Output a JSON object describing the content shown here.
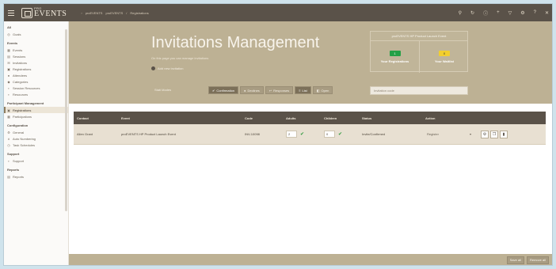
{
  "topbar": {
    "logo_small": "PRO",
    "logo_big": "EVENTS",
    "breadcrumbs": [
      "proEVENTS",
      "proEVENTS",
      "Registrations"
    ],
    "icons": [
      "pin-icon",
      "refresh-icon",
      "info-icon",
      "plus-icon",
      "filter-icon",
      "gear-icon",
      "help-icon",
      "close-icon"
    ]
  },
  "sidebar": {
    "top_section": "All",
    "top_item": "Goals",
    "sections": [
      {
        "title": "Events",
        "items": [
          "Events",
          "Sessions",
          "Invitations",
          "Registrations",
          "Attendees",
          "Categories",
          "Session Resources",
          "Resources"
        ]
      },
      {
        "title": "Participant Management",
        "items": [
          "Registrations",
          "Participations"
        ]
      },
      {
        "title": "Configuration",
        "items": [
          "General",
          "Auto Numbering",
          "Task Schedules"
        ]
      },
      {
        "title": "Support",
        "items": [
          "Support"
        ]
      },
      {
        "title": "Reports",
        "items": [
          "Reports"
        ]
      }
    ]
  },
  "header": {
    "title": "Invitations Management",
    "subtitle": "On this page you can manage invitations",
    "add_label": "Add new invitation",
    "stats_title": "proEVENTS HP Product Launch Event",
    "stat_left_value": "1",
    "stat_left_label": "Your Registrations",
    "stat_right_value": "0",
    "stat_right_label": "Your Waitlist",
    "view_label": "Stati Modes",
    "view_buttons": [
      "Confirmation",
      "Declines",
      "Responses",
      "List",
      "Open"
    ],
    "search_placeholder": "Invitation code"
  },
  "table": {
    "columns": [
      "Contact",
      "Event",
      "Code",
      "Adults",
      "Children",
      "Status",
      "Action"
    ],
    "rows": [
      {
        "contact": "Allen Grant",
        "event": "proEVENTS HP Product Launch Event",
        "code": "INV-10098",
        "adults": "2",
        "children": "0",
        "status": "Invite/Confirmed",
        "action": "Register"
      }
    ]
  },
  "footer": {
    "save_all": "Save all",
    "remove_all": "Remove all"
  }
}
